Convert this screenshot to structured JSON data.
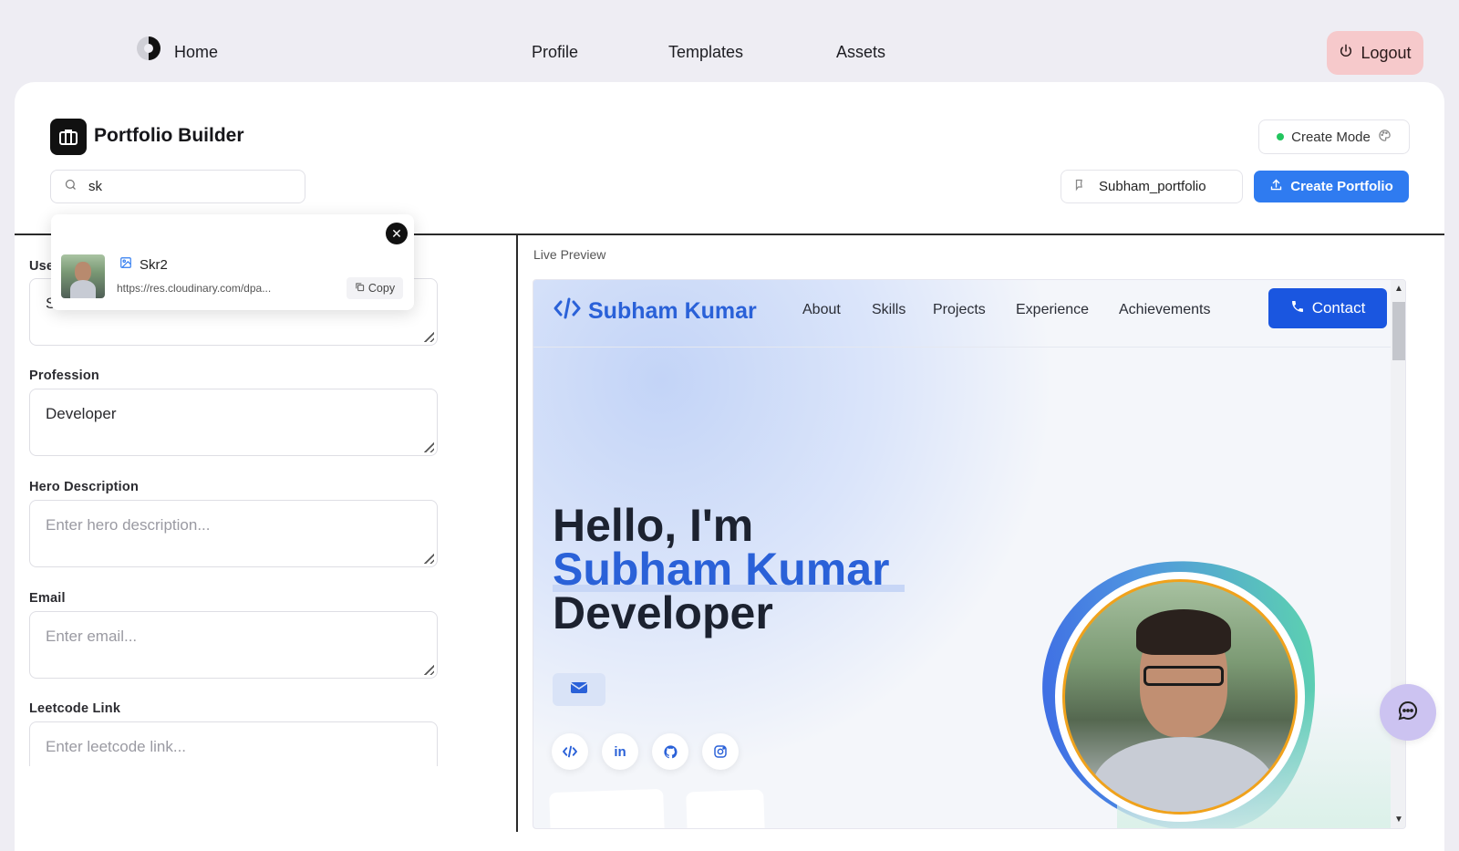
{
  "nav": {
    "home": "Home",
    "links": [
      "Profile",
      "Templates",
      "Assets"
    ],
    "logout": "Logout"
  },
  "header": {
    "title": "Portfolio Builder",
    "search_value": "sk",
    "create_mode": "Create Mode",
    "portfolio_name": "Subham_portfolio",
    "create_button": "Create Portfolio"
  },
  "popup": {
    "asset_name": "Skr2",
    "asset_url": "https://res.cloudinary.com/dpa...",
    "copy_label": "Copy"
  },
  "form": {
    "username_label_partial": "Use",
    "username_value_partial": "S",
    "profession_label": "Profession",
    "profession_value": "Developer",
    "hero_label": "Hero Description",
    "hero_placeholder": "Enter hero description...",
    "email_label": "Email",
    "email_placeholder": "Enter email...",
    "leetcode_label": "Leetcode Link",
    "leetcode_placeholder": "Enter leetcode link..."
  },
  "preview": {
    "label": "Live Preview",
    "logo_text": "Subham Kumar",
    "nav_links": [
      "About",
      "Skills",
      "Projects",
      "Experience",
      "Achievements"
    ],
    "contact_button": "Contact",
    "hero_greeting": "Hello, I'm",
    "hero_name": "Subham Kumar",
    "hero_role": "Developer",
    "socials": [
      "code-icon",
      "linkedin-icon",
      "github-icon",
      "instagram-icon"
    ]
  },
  "colors": {
    "primary_blue": "#2f7bf0",
    "preview_blue": "#2a61d8",
    "logout_bg": "#f6c9cb",
    "chat_fab": "#ccc3f1",
    "status_green": "#22c55e"
  }
}
